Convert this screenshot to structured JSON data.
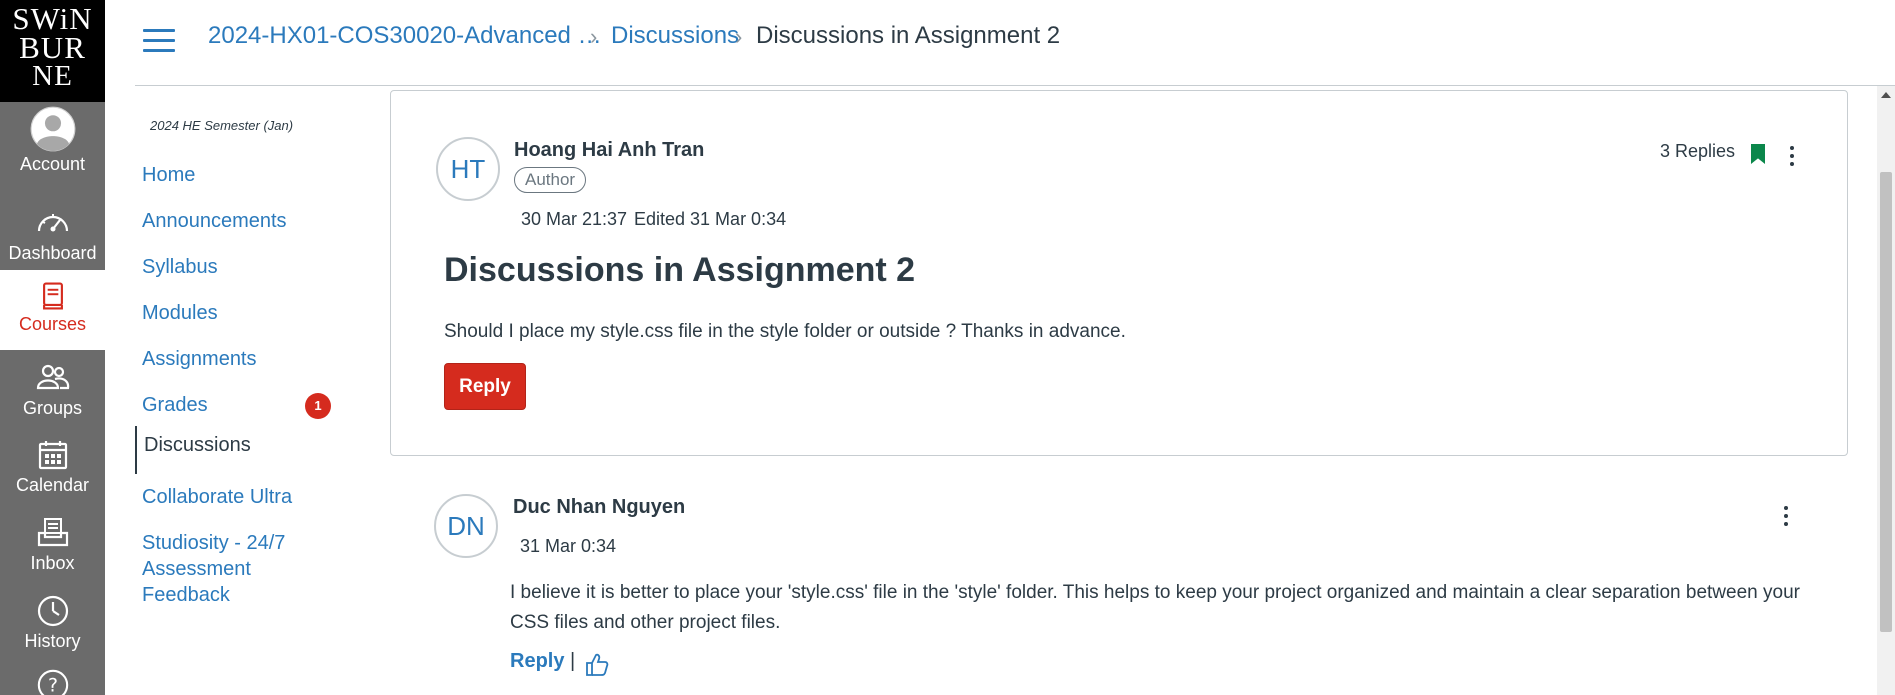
{
  "logo": {
    "lines": [
      "SWiN",
      "BUR",
      "NE"
    ]
  },
  "global_nav": [
    {
      "label": "Account",
      "icon": "account-icon"
    },
    {
      "label": "Dashboard",
      "icon": "dashboard-icon"
    },
    {
      "label": "Courses",
      "icon": "courses-icon",
      "active": true
    },
    {
      "label": "Groups",
      "icon": "groups-icon"
    },
    {
      "label": "Calendar",
      "icon": "calendar-icon"
    },
    {
      "label": "Inbox",
      "icon": "inbox-icon"
    },
    {
      "label": "History",
      "icon": "history-icon"
    },
    {
      "label": "",
      "icon": "help-icon"
    }
  ],
  "breadcrumb": {
    "course": "2024-HX01-COS30020-Advanced …",
    "section": "Discussions",
    "current": "Discussions in Assignment 2"
  },
  "course_nav": {
    "term": "2024 HE Semester (Jan)",
    "items": [
      {
        "label": "Home"
      },
      {
        "label": "Announcements"
      },
      {
        "label": "Syllabus"
      },
      {
        "label": "Modules"
      },
      {
        "label": "Assignments"
      },
      {
        "label": "Grades",
        "badge": "1"
      },
      {
        "label": "Discussions",
        "active": true
      },
      {
        "label": "Collaborate Ultra"
      },
      {
        "label": "Studiosity - 24/7 Assessment Feedback"
      }
    ]
  },
  "post": {
    "avatar_initials": "HT",
    "author": "Hoang Hai Anh Tran",
    "role": "Author",
    "posted": "30 Mar 21:37",
    "edited": "Edited 31 Mar 0:34",
    "replies": "3 Replies",
    "title": "Discussions in Assignment 2",
    "body": "Should I place my style.css file in the style folder or outside ? Thanks in advance.",
    "reply_label": "Reply"
  },
  "reply": {
    "avatar_initials": "DN",
    "author": "Duc Nhan Nguyen",
    "posted": "31 Mar 0:34",
    "body": "I believe it is better to place your 'style.css' file in the 'style' folder. This helps to keep your project organized and maintain a clear separation between your CSS files and other project files.",
    "reply_label": "Reply",
    "separator": "|"
  },
  "colors": {
    "accent": "#2b7abc",
    "brand_red": "#d52b1e",
    "nav_bg": "#6b6b6b",
    "bookmark": "#0b874b"
  }
}
